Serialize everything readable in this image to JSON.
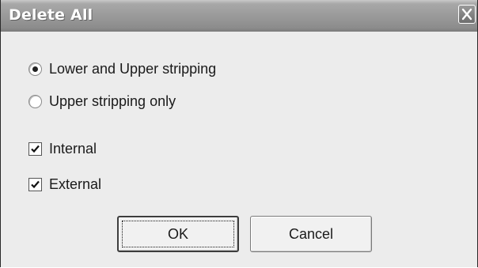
{
  "dialog": {
    "title": "Delete All",
    "close_icon": "close-icon"
  },
  "stripping_options": [
    {
      "label": "Lower and Upper stripping",
      "selected": true
    },
    {
      "label": "Upper stripping only",
      "selected": false
    }
  ],
  "scope_options": [
    {
      "label": "Internal",
      "checked": true
    },
    {
      "label": "External",
      "checked": true
    }
  ],
  "buttons": {
    "ok_label": "OK",
    "cancel_label": "Cancel"
  }
}
